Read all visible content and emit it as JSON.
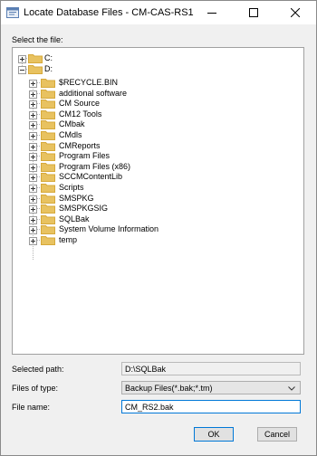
{
  "window": {
    "title": "Locate Database Files - CM-CAS-RS1"
  },
  "dialog": {
    "select_label": "Select the file:",
    "tree": {
      "drives": [
        {
          "label": "C:",
          "expanded": false
        },
        {
          "label": "D:",
          "expanded": true
        }
      ],
      "folders": [
        "$RECYCLE.BIN",
        "additional software",
        "CM Source",
        "CM12 Tools",
        "CMbak",
        "CMdls",
        "CMReports",
        "Program Files",
        "Program Files (x86)",
        "SCCMContentLib",
        "Scripts",
        "SMSPKG",
        "SMSPKGSIG",
        "SQLBak",
        "System Volume Information",
        "temp"
      ]
    },
    "selected_path": {
      "label": "Selected path:",
      "value": "D:\\SQLBak"
    },
    "files_of_type": {
      "label": "Files of type:",
      "value": "Backup Files(*.bak;*.tm)"
    },
    "file_name": {
      "label": "File name:",
      "value": "CM_RS2.bak"
    },
    "buttons": {
      "ok": "OK",
      "cancel": "Cancel"
    }
  },
  "colors": {
    "accent": "#0078d7",
    "folder": "#e8c260",
    "folder_dark": "#d6a93a"
  }
}
